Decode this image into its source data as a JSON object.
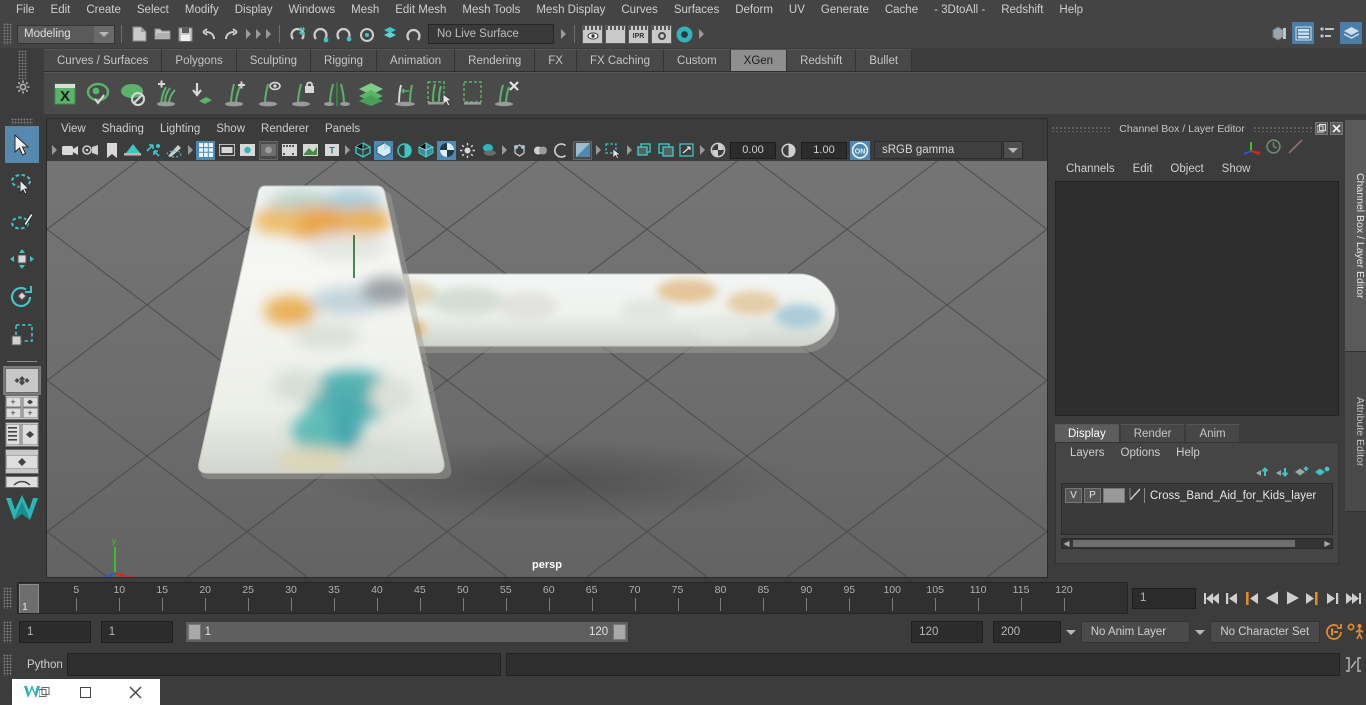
{
  "app": {
    "menu_items": [
      "File",
      "Edit",
      "Create",
      "Select",
      "Modify",
      "Display",
      "Windows",
      "Mesh",
      "Edit Mesh",
      "Mesh Tools",
      "Mesh Display",
      "Curves",
      "Surfaces",
      "Deform",
      "UV",
      "Generate",
      "Cache",
      "- 3DtoAll -",
      "Redshift",
      "Help"
    ]
  },
  "status_line": {
    "menu_set": "Modeling",
    "live_surface": "No Live Surface",
    "render_icons": [
      "render-current-frame-icon",
      "ipr-render-icon",
      "ipr-label-icon",
      "render-settings-icon",
      "render-view-icon"
    ],
    "top_right_icons": [
      "modeling-toolkit-icon",
      "attribute-editor-icon",
      "tool-settings-icon",
      "channel-box-icon"
    ]
  },
  "shelf": {
    "tabs": [
      "Curves / Surfaces",
      "Polygons",
      "Sculpting",
      "Rigging",
      "Animation",
      "Rendering",
      "FX",
      "FX Caching",
      "Custom",
      "XGen",
      "Redshift",
      "Bullet"
    ],
    "active_tab": "XGen",
    "icons": [
      "xgen-editor-icon",
      "xgen-preview-icon",
      "xgen-render-icon",
      "xgen-add-clump-icon",
      "xgen-import-icon",
      "xgen-add-guide-icon",
      "xgen-select-guide-icon",
      "xgen-lock-guide-icon",
      "xgen-mirror-guide-icon",
      "xgen-layers-icon",
      "xgen-convert-icon",
      "xgen-select-region-icon",
      "xgen-clear-region-icon",
      "xgen-delete-guide-icon"
    ],
    "accent_color": "#5bb36a"
  },
  "toolbox": {
    "tools": [
      "select-tool",
      "lasso-select-tool",
      "paint-select-tool",
      "move-tool",
      "rotate-tool",
      "scale-tool"
    ],
    "active_tool": "select-tool",
    "layouts": [
      "single-pane-layout",
      "four-pane-layout",
      "outliner-persp-layout",
      "hypershade-persp-layout",
      "persp-graph-layout"
    ]
  },
  "viewport": {
    "menus": [
      "View",
      "Shading",
      "Lighting",
      "Show",
      "Renderer",
      "Panels"
    ],
    "camera_label": "persp",
    "exposure": "0.00",
    "gamma": "1.00",
    "color_management": "sRGB gamma",
    "color_management_toggle": "ON",
    "background_color": "#6e6e6e",
    "grid_color": "#474747",
    "axis_gizmo": {
      "x": "x",
      "y": "y",
      "z": "z",
      "x_color": "#d9281e",
      "y_color": "#3fc020",
      "z_color": "#2e56d4"
    },
    "model_name": "Cross_Band_Aid_for_Kids"
  },
  "right_panel": {
    "title": "Channel Box / Layer Editor",
    "channel_menus": [
      "Channels",
      "Edit",
      "Object",
      "Show"
    ],
    "layer_tabs": [
      "Display",
      "Render",
      "Anim"
    ],
    "active_layer_tab": "Display",
    "layer_menus": [
      "Layers",
      "Options",
      "Help"
    ],
    "layers": [
      {
        "visibility": "V",
        "playback": "P",
        "name": "Cross_Band_Aid_for_Kids_layer"
      }
    ],
    "vertical_tabs": [
      "Channel Box / Layer Editor",
      "Attribute Editor"
    ],
    "active_vertical_tab": "Channel Box / Layer Editor"
  },
  "time_slider": {
    "current_frame": "1",
    "ticks": [
      5,
      10,
      15,
      20,
      25,
      30,
      35,
      40,
      45,
      50,
      55,
      60,
      65,
      70,
      75,
      80,
      85,
      90,
      95,
      100,
      105,
      110,
      115,
      120
    ],
    "start": 1,
    "end": 120,
    "playback_buttons": [
      "go-to-start-icon",
      "step-back-keyframe-icon",
      "step-back-frame-icon",
      "play-backwards-icon",
      "play-forwards-icon",
      "step-forward-frame-icon",
      "step-forward-keyframe-icon",
      "go-to-end-icon"
    ]
  },
  "range_slider": {
    "anim_start": "1",
    "range_start": "1",
    "bar_start": "1",
    "bar_end": "120",
    "range_end": "120",
    "anim_end": "200",
    "anim_layer": "No Anim Layer",
    "character_set": "No Character Set",
    "auto_key": "auto-keyframe-icon",
    "anim_prefs": "animation-preferences-icon",
    "accent_color": "#e08a2e"
  },
  "command_line": {
    "language": "Python",
    "input_value": "",
    "output_value": "",
    "script_editor_icon": "script-editor-icon"
  },
  "taskbar": {
    "app_icon": "maya-app-icon",
    "restore_icon": "restore-window-icon",
    "minimize_icon": "minimize-window-icon",
    "close_icon": "close-window-icon"
  }
}
